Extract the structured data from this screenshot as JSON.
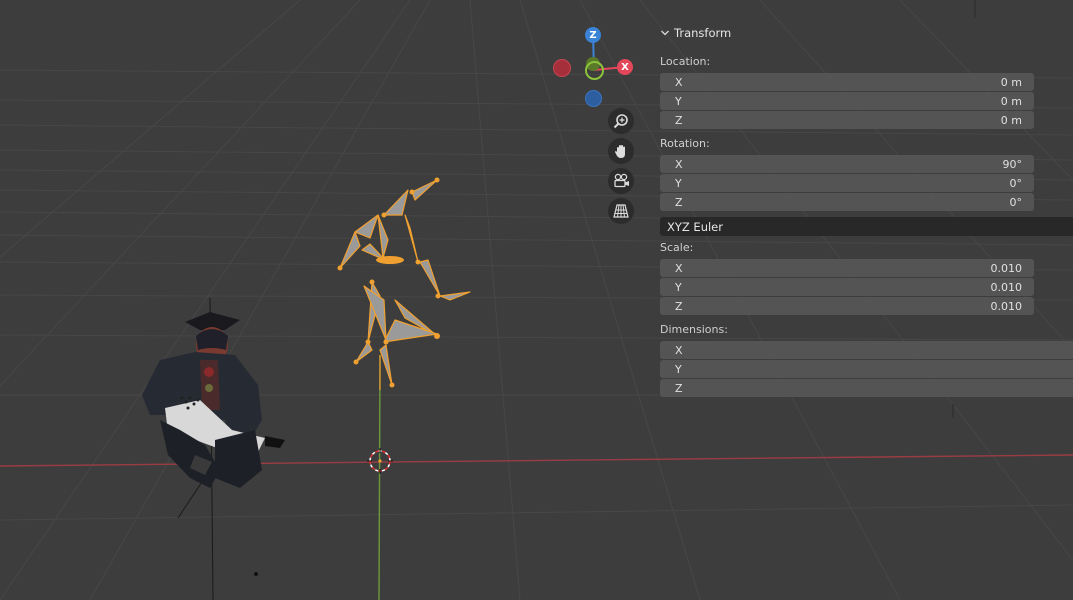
{
  "gizmo": {
    "z_label": "Z",
    "x_label": "X",
    "colors": {
      "x": "#e5475a",
      "y": "#8bc43b",
      "z": "#3a83d6",
      "x_neg": "#a5303b",
      "z_neg": "#2c5ea0"
    }
  },
  "nav_buttons": [
    {
      "icon": "zoom-icon"
    },
    {
      "icon": "hand-pan-icon"
    },
    {
      "icon": "camera-icon"
    },
    {
      "icon": "grid-perspective-icon"
    }
  ],
  "transform": {
    "title": "Transform",
    "location": {
      "label": "Location:",
      "x": {
        "axis": "X",
        "value": "0 m"
      },
      "y": {
        "axis": "Y",
        "value": "0 m"
      },
      "z": {
        "axis": "Z",
        "value": "0 m"
      }
    },
    "rotation": {
      "label": "Rotation:",
      "x": {
        "axis": "X",
        "value": "90°"
      },
      "y": {
        "axis": "Y",
        "value": "0°"
      },
      "z": {
        "axis": "Z",
        "value": "0°"
      }
    },
    "rotation_mode": "XYZ Euler",
    "scale": {
      "label": "Scale:",
      "x": {
        "axis": "X",
        "value": "0.010"
      },
      "y": {
        "axis": "Y",
        "value": "0.010"
      },
      "z": {
        "axis": "Z",
        "value": "0.010"
      }
    },
    "dimensions": {
      "label": "Dimensions:",
      "x": {
        "axis": "X",
        "value": ""
      },
      "y": {
        "axis": "Y",
        "value": ""
      },
      "z": {
        "axis": "Z",
        "value": ""
      }
    }
  },
  "colors": {
    "background": "#3d3d3d",
    "grid_line": "#484848",
    "x_axis": "#9a3c44",
    "y_axis": "#6c9a3a",
    "armature_outline": "#f0a030",
    "armature_fill": "#9a9a9a",
    "panel_field": "#545454",
    "dropdown": "#282828"
  }
}
